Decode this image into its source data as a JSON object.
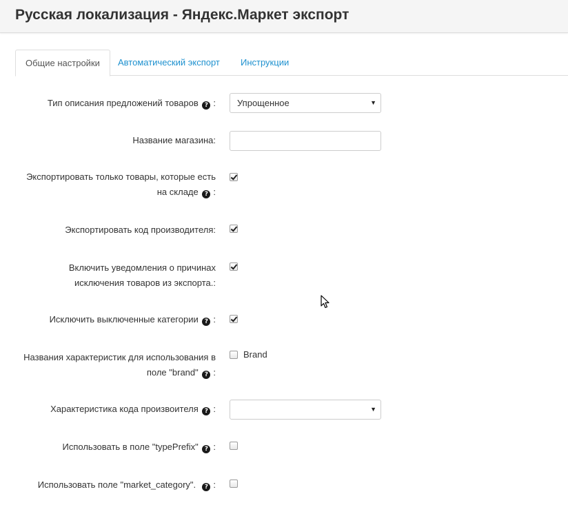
{
  "header": {
    "title": "Русская локализация - Яндекс.Маркет экспорт"
  },
  "tabs": [
    {
      "label": "Общие настройки"
    },
    {
      "label": "Автоматический экспорт"
    },
    {
      "label": "Инструкции"
    }
  ],
  "help_glyph": "?",
  "form": {
    "offer_type": {
      "label": "Тип описания предложений товаров",
      "value": "Упрощенное"
    },
    "shop_name": {
      "label": "Название магазина:",
      "value": ""
    },
    "in_stock_only": {
      "label_line1": "Экспортировать только товары, которые есть",
      "label_line2": "на складе",
      "checked": true
    },
    "export_manufacturer_code": {
      "label": "Экспортировать код производителя:",
      "checked": true
    },
    "exclusion_notifications": {
      "label_line1": "Включить уведомления о причинах",
      "label_line2": "исключения товаров из экспорта.:",
      "checked": true
    },
    "exclude_disabled_categories": {
      "label": "Исключить выключенные категории",
      "checked": true
    },
    "brand_attributes": {
      "label_line1": "Названия характеристик для использования в",
      "label_line2": "поле \"brand\"",
      "option_label": "Brand",
      "checked": false
    },
    "manufacturer_code_attribute": {
      "label": "Характеристика кода произвоителя",
      "value": ""
    },
    "type_prefix": {
      "label": "Использовать в поле \"typePrefix\"",
      "checked": false
    },
    "market_category": {
      "label": "Использовать поле \"market_category\".",
      "checked": false
    }
  },
  "colors": {
    "link": "#1e91cf",
    "header_bg": "#f5f5f5",
    "text": "#333333"
  }
}
